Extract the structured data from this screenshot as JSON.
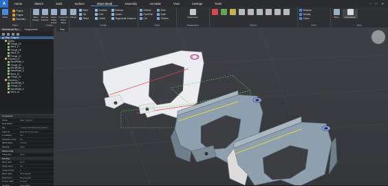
{
  "app": {
    "logo": "A"
  },
  "menu": [
    "Home",
    "Sketch",
    "Solid",
    "Surface",
    "Sheet Metal",
    "Assembly",
    "Annotate",
    "View",
    "Settings",
    "Tools"
  ],
  "menu_active_index": 4,
  "ribbon": {
    "groups": [
      "Plane",
      "Create",
      "Modify",
      "Solid",
      "Parameters",
      "Select",
      "Pixel",
      "View"
    ],
    "buttons": {
      "plane": "Plane",
      "sketch": "Sketch",
      "base": "Base Flange",
      "extrude": "Extrude Polyline",
      "sheet": "Sheet Metal Lofted",
      "convert": "Convert to Sheet Metal",
      "flange": "Flange",
      "parameters": "Parameters",
      "body": "Body",
      "featureless": "Featureless"
    },
    "small": {
      "project": "Project",
      "project2": "Project",
      "boundary": "Boundary",
      "bend": "Bend",
      "rip": "Rip",
      "relief": "Relief",
      "junction": "Junction",
      "fold": "Fold",
      "unfold": "Unfold",
      "emboss": "Emboss",
      "louvre": "Louvre",
      "flatten": "Flatten",
      "fillet": "Fillet",
      "break": "Break",
      "regenerate": "Regenerate Features",
      "extrude": "Extrude",
      "push": "Push/Pull",
      "cut": "Cut",
      "shell": "Shell",
      "draft": "Draft",
      "emerg": "Emerg",
      "thicken": "Thicken",
      "measure": "Measure",
      "simplify": "Simplify",
      "check": "Check"
    }
  },
  "tree": {
    "tabs": [
      "Mechanical Bro...",
      "Components"
    ],
    "nodes": [
      {
        "label": "Step_Support",
        "level": 0,
        "kind": "root",
        "selected": true
      },
      {
        "label": "Bodies",
        "level": 1,
        "kind": "fold"
      },
      {
        "label": "Flange_10",
        "level": 2,
        "kind": "feat"
      },
      {
        "label": "Bend_17",
        "level": 2,
        "kind": "feat"
      },
      {
        "label": "Flange_18",
        "level": 2,
        "kind": "feat"
      },
      {
        "label": "Bend_19",
        "level": 2,
        "kind": "feat"
      },
      {
        "label": "Flange_14",
        "level": 2,
        "kind": "feat"
      },
      {
        "label": "Extrusion_6",
        "level": 1,
        "kind": "fold"
      },
      {
        "label": "BendRelief_1",
        "level": 2,
        "kind": "feat"
      },
      {
        "label": "Flange_20",
        "level": 2,
        "kind": "feat"
      },
      {
        "label": "BendRelief_2",
        "level": 2,
        "kind": "feat"
      },
      {
        "label": "BendRelief_3",
        "level": 2,
        "kind": "feat"
      },
      {
        "label": "Bend_21",
        "level": 2,
        "kind": "feat"
      },
      {
        "label": "Flange_22",
        "level": 2,
        "kind": "feat"
      },
      {
        "label": "Extrusion_7",
        "level": 1,
        "kind": "fold"
      },
      {
        "label": "BendRelief_5",
        "level": 2,
        "kind": "feat"
      },
      {
        "label": "Flange_23",
        "level": 2,
        "kind": "feat"
      },
      {
        "label": "BendRelief_6",
        "level": 2,
        "kind": "feat"
      },
      {
        "label": "Bend_10",
        "level": 2,
        "kind": "feat"
      }
    ]
  },
  "properties": {
    "rows": [
      {
        "k": "Component",
        "v": "",
        "section": true
      },
      {
        "k": "Name",
        "v": "Step_Support"
      },
      {
        "k": "Description",
        "v": ""
      },
      {
        "k": "File",
        "v": "C:\\Users\\Public\\Desktop\\Mech..."
      },
      {
        "k": "Insert as",
        "v": "External component"
      },
      {
        "k": "Is editable",
        "v": "Yes"
      },
      {
        "k": "Standard comp",
        "v": "No"
      },
      {
        "k": "BOM status",
        "v": "Include"
      },
      {
        "k": "Material",
        "v": "Steel"
      },
      {
        "k": "Sheet metal",
        "v": "",
        "section": true
      },
      {
        "k": "Thickness",
        "v": "1mm"
      },
      {
        "k": "Bending",
        "v": "",
        "section": true
      },
      {
        "k": "Bend radii",
        "v": "1mm"
      },
      {
        "k": "Sharp bend",
        "v": "No"
      },
      {
        "k": "Lofted bends",
        "v": "1"
      },
      {
        "k": "Bend relief",
        "v": "Rectangular"
      },
      {
        "k": "Relief form",
        "v": "Rectangular"
      },
      {
        "k": "Corner relief",
        "v": "Circular"
      },
      {
        "k": "Junction",
        "v": "Close Miter"
      }
    ]
  },
  "viewport": {
    "tab": "Step"
  },
  "colors": {
    "accent": "#3d8fe0",
    "part": "#8a9aa6",
    "bend_line": "#e6d54a"
  }
}
